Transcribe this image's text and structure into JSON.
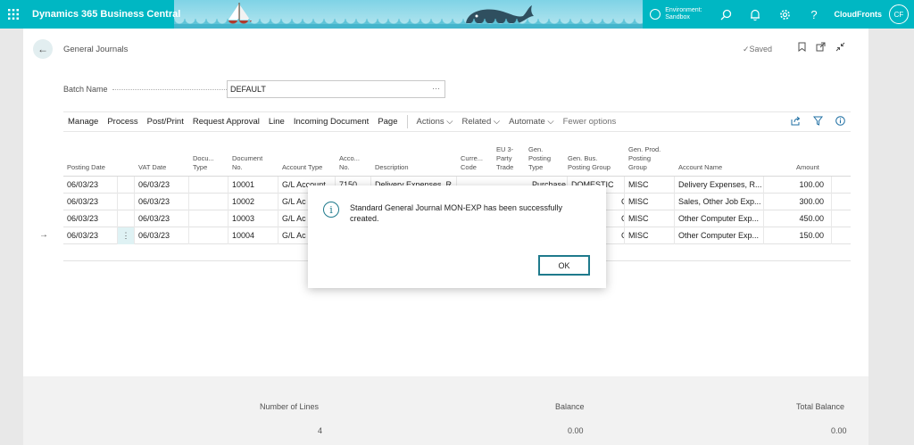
{
  "topbar": {
    "app_title": "Dynamics 365 Business Central",
    "environment_label": "Environment:",
    "environment_value": "Sandbox",
    "tenant": "CloudFronts",
    "avatar_initials": "CF",
    "brand_color": "#00b7c3"
  },
  "header": {
    "back_icon": "←",
    "page_title": "General Journals",
    "saved_text": "✓Saved"
  },
  "batch": {
    "label": "Batch Name",
    "value": "DEFAULT",
    "lookup_icon": "···"
  },
  "actions": {
    "items": [
      "Manage",
      "Process",
      "Post/Print",
      "Request Approval",
      "Line",
      "Incoming Document",
      "Page"
    ],
    "dropdowns": [
      "Actions ⌵",
      "Related ⌵",
      "Automate ⌵"
    ],
    "fewer": "Fewer options"
  },
  "grid": {
    "headers": {
      "posting_date": "Posting Date",
      "vat_date": "VAT Date",
      "doc_type": [
        "Docu...",
        "Type"
      ],
      "doc_no": [
        "Document",
        "No."
      ],
      "account_type": "Account Type",
      "account_no": [
        "Acco...",
        "No."
      ],
      "description": "Description",
      "currency": [
        "Curre...",
        "Code"
      ],
      "eu3": [
        "EU 3-",
        "Party",
        "Trade"
      ],
      "gen_posting_type": [
        "Gen.",
        "Posting",
        "Type"
      ],
      "gen_bus": [
        "Gen. Bus.",
        "Posting Group"
      ],
      "gen_prod": [
        "Gen. Prod.",
        "Posting",
        "Group"
      ],
      "account_name": "Account Name",
      "amount": "Amount"
    },
    "rows": [
      {
        "posting_date": "06/03/23",
        "vat_date": "06/03/23",
        "doc_no": "10001",
        "account_type": "G/L Account",
        "account_no": "7150",
        "description": "Delivery Expenses, R...",
        "gen_posting_type": "Purchase",
        "gen_bus": "DOMESTIC",
        "gen_prod": "MISC",
        "account_name": "Delivery Expenses, R...",
        "amount": "100.00"
      },
      {
        "posting_date": "06/03/23",
        "vat_date": "06/03/23",
        "doc_no": "10002",
        "account_type": "G/L Ac",
        "account_no": "",
        "description": "",
        "gen_posting_type": "",
        "gen_bus": "C",
        "gen_prod": "MISC",
        "account_name": "Sales, Other Job Exp...",
        "amount": "300.00"
      },
      {
        "posting_date": "06/03/23",
        "vat_date": "06/03/23",
        "doc_no": "10003",
        "account_type": "G/L Ac",
        "account_no": "",
        "description": "",
        "gen_posting_type": "",
        "gen_bus": "C",
        "gen_prod": "MISC",
        "account_name": "Other Computer Exp...",
        "amount": "450.00"
      },
      {
        "posting_date": "06/03/23",
        "vat_date": "06/03/23",
        "doc_no": "10004",
        "account_type": "G/L Ac",
        "account_no": "",
        "description": "",
        "gen_posting_type": "",
        "gen_bus": "C",
        "gen_prod": "MISC",
        "account_name": "Other Computer Exp...",
        "amount": "150.00"
      }
    ]
  },
  "totals": {
    "lines_label": "Number of Lines",
    "lines_value": "4",
    "balance_label": "Balance",
    "balance_value": "0.00",
    "total_balance_label": "Total Balance",
    "total_balance_value": "0.00"
  },
  "dialog": {
    "message": "Standard General Journal MON-EXP has been successfully created.",
    "ok_label": "OK",
    "accent_color": "#1f7a8c"
  }
}
